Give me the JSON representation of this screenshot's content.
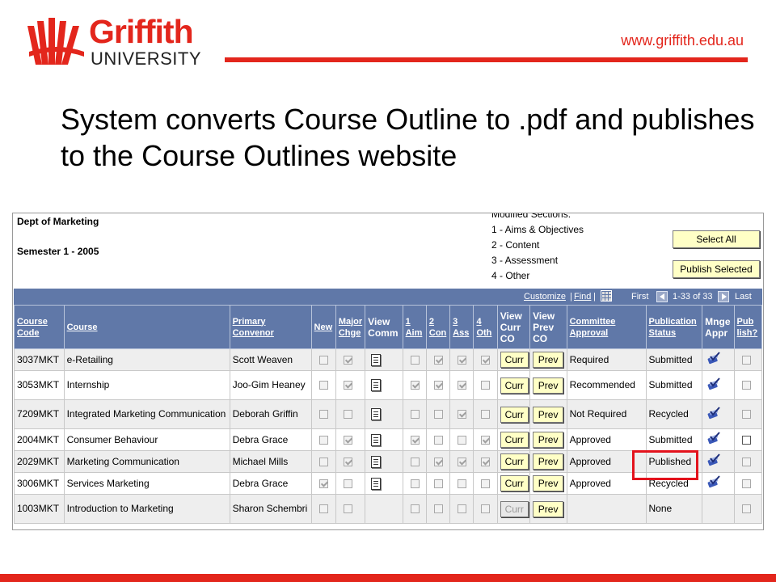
{
  "slide": {
    "logo": {
      "word1": "Griffith",
      "word2": "UNIVERSITY"
    },
    "url": "www.griffith.edu.au",
    "title": "System converts Course Outline to .pdf and publishes to the Course Outlines website"
  },
  "colors": {
    "brand_red": "#e3261c",
    "grid_header": "#6078a8",
    "button_yellow": "#ffffc6"
  },
  "app": {
    "dept": "Dept of Marketing",
    "semester": "Semester 1 - 2005",
    "modified_heading": "Modified Sections:",
    "modified_items": [
      "1 - Aims & Objectives",
      "2 - Content",
      "3 - Assessment",
      "4 - Other"
    ],
    "select_all": "Select All",
    "publish_selected": "Publish Selected",
    "nav": {
      "customize": "Customize",
      "separator": "|",
      "find": "Find",
      "separator2": "|",
      "first": "First",
      "range": "1-33 of 33",
      "last": "Last"
    },
    "columns": {
      "course_code": [
        "Course",
        "Code"
      ],
      "course": "Course",
      "primary_convenor": [
        "Primary",
        "Convenor"
      ],
      "new": "New",
      "major_chge": [
        "Major",
        "Chge"
      ],
      "view_comm": [
        "View",
        "Comm"
      ],
      "aim": [
        "1",
        "Aim"
      ],
      "con": [
        "2",
        "Con"
      ],
      "ass": [
        "3",
        "Ass"
      ],
      "oth": [
        "4",
        "Oth"
      ],
      "view_curr": [
        "View",
        "Curr",
        "CO"
      ],
      "view_prev": [
        "View",
        "Prev",
        "CO"
      ],
      "committee_approval": [
        "Committee",
        "Approval"
      ],
      "publication_status": [
        "Publication",
        "Status"
      ],
      "mnge_appr": [
        "Mnge",
        "Appr"
      ],
      "publish": [
        "Pub",
        "lish?"
      ]
    },
    "curr_label": "Curr",
    "prev_label": "Prev",
    "rows": [
      {
        "code": "3037MKT",
        "course": "e-Retailing",
        "convenor": "Scott Weaven",
        "new": false,
        "major": true,
        "comm": true,
        "aim": false,
        "con": true,
        "ass": true,
        "oth": true,
        "curr_enabled": true,
        "approval": "Required",
        "status": "Submitted",
        "mnge": true,
        "publish_active": false
      },
      {
        "code": "3053MKT",
        "course": "Internship",
        "convenor": "Joo-Gim Heaney",
        "new": false,
        "major": true,
        "comm": true,
        "aim": true,
        "con": true,
        "ass": true,
        "oth": false,
        "curr_enabled": true,
        "approval": "Recommended",
        "status": "Submitted",
        "mnge": true,
        "publish_active": false
      },
      {
        "code": "7209MKT",
        "course": "Integrated Marketing Communication",
        "convenor": "Deborah Griffin",
        "new": false,
        "major": false,
        "comm": true,
        "aim": false,
        "con": false,
        "ass": true,
        "oth": false,
        "curr_enabled": true,
        "approval": "Not Required",
        "status": "Recycled",
        "mnge": true,
        "publish_active": false
      },
      {
        "code": "2004MKT",
        "course": "Consumer Behaviour",
        "convenor": "Debra Grace",
        "new": false,
        "major": true,
        "comm": true,
        "aim": true,
        "con": false,
        "ass": false,
        "oth": true,
        "curr_enabled": true,
        "approval": "Approved",
        "status": "Submitted",
        "mnge": true,
        "publish_active": true
      },
      {
        "code": "2029MKT",
        "course": "Marketing Communication",
        "convenor": "Michael Mills",
        "new": false,
        "major": true,
        "comm": true,
        "aim": false,
        "con": true,
        "ass": true,
        "oth": true,
        "curr_enabled": true,
        "approval": "Approved",
        "status": "Published",
        "mnge": true,
        "publish_active": false
      },
      {
        "code": "3006MKT",
        "course": "Services Marketing",
        "convenor": "Debra Grace",
        "new": true,
        "major": false,
        "comm": true,
        "aim": false,
        "con": false,
        "ass": false,
        "oth": false,
        "curr_enabled": true,
        "approval": "Approved",
        "status": "Recycled",
        "mnge": true,
        "publish_active": false
      },
      {
        "code": "1003MKT",
        "course": "Introduction to Marketing",
        "convenor": "Sharon Schembri",
        "new": false,
        "major": false,
        "comm": false,
        "aim": false,
        "con": false,
        "ass": false,
        "oth": false,
        "curr_enabled": false,
        "approval": "",
        "status": "None",
        "mnge": false,
        "publish_active": false
      }
    ]
  }
}
